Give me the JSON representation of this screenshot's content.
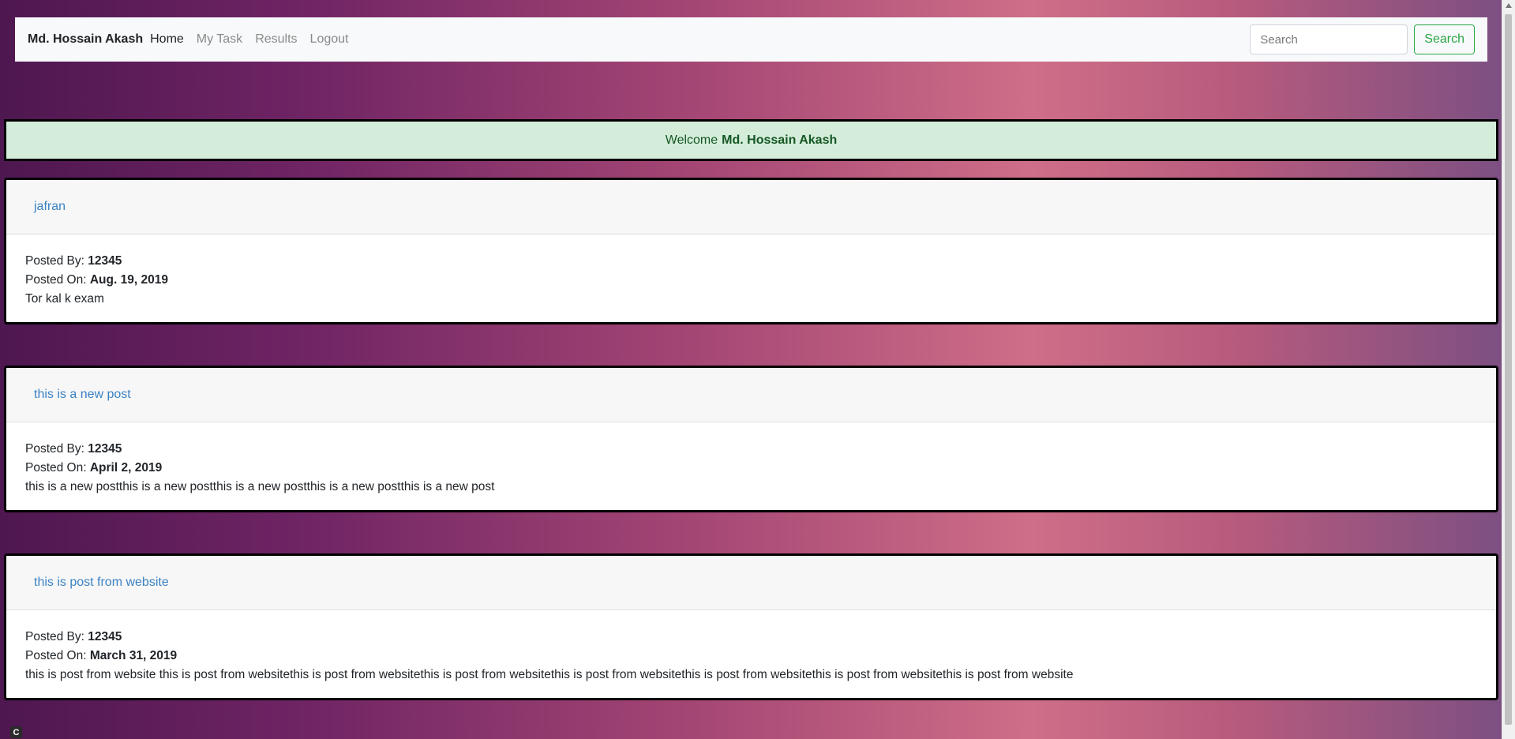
{
  "navbar": {
    "brand": "Md. Hossain Akash",
    "links": [
      "Home",
      "My Task",
      "Results",
      "Logout"
    ],
    "search": {
      "placeholder": "Search",
      "button_label": "Search"
    }
  },
  "welcome": {
    "prefix": "Welcome",
    "name": "Md. Hossain Akash"
  },
  "posts": [
    {
      "title": "jafran",
      "posted_by_label": "Posted By:",
      "posted_by": "12345",
      "posted_on_label": "Posted On:",
      "posted_on": "Aug. 19, 2019",
      "content": "Tor kal k exam"
    },
    {
      "title": "this is a new post",
      "posted_by_label": "Posted By:",
      "posted_by": "12345",
      "posted_on_label": "Posted On:",
      "posted_on": "April 2, 2019",
      "content": "this is a new postthis is a new postthis is a new postthis is a new postthis is a new post"
    },
    {
      "title": "this is post from website",
      "posted_by_label": "Posted By:",
      "posted_by": "12345",
      "posted_on_label": "Posted On:",
      "posted_on": "March 31, 2019",
      "content": "this is post from website this is post from websitethis is post from websitethis is post from websitethis is post from websitethis is post from websitethis is post from websitethis is post from website"
    }
  ],
  "corner_icon_letter": "C"
}
